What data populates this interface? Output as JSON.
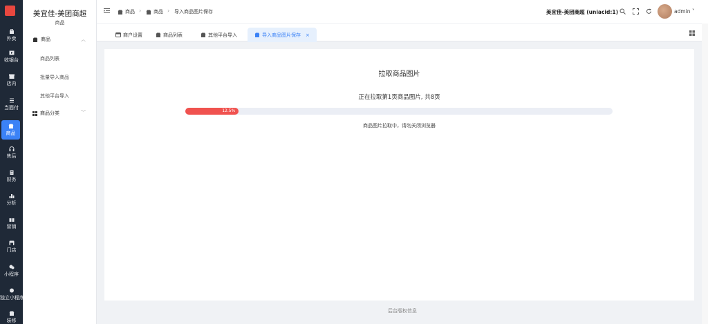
{
  "rail": {
    "logo_text": "美宜佳",
    "items": [
      {
        "label": "外卖",
        "icon": "bag-icon"
      },
      {
        "label": "收银台",
        "icon": "cashier-icon"
      },
      {
        "label": "店内",
        "icon": "store-icon"
      },
      {
        "label": "当面付",
        "icon": "list-icon"
      },
      {
        "label": "商品",
        "icon": "goods-icon",
        "active": true
      },
      {
        "label": "售后",
        "icon": "headset-icon"
      },
      {
        "label": "财务",
        "icon": "finance-icon"
      },
      {
        "label": "分析",
        "icon": "chart-icon"
      },
      {
        "label": "营销",
        "icon": "gift-icon"
      },
      {
        "label": "门店",
        "icon": "shop-icon"
      },
      {
        "label": "小程序",
        "icon": "miniapp-icon"
      },
      {
        "label": "独立小程序",
        "icon": "miniapp-standalone-icon"
      },
      {
        "label": "装修",
        "icon": "decorate-icon"
      }
    ]
  },
  "subnav": {
    "store_name": "美宜佳-美团商超",
    "store_sub": "商品",
    "groups": [
      {
        "label": "商品",
        "icon": "goods-icon",
        "items": [
          "商品列表",
          "批量导入商品",
          "其他平台导入"
        ]
      },
      {
        "label": "商品分类",
        "icon": "category-grid-icon",
        "items": []
      }
    ]
  },
  "header": {
    "breadcrumbs": [
      "商品",
      "商品",
      "导入商品图片保存"
    ],
    "store_title": "美宜佳-美团商超 (uniacid:1)",
    "user": "admin"
  },
  "tabs": [
    {
      "label": "商户设置",
      "icon": "tab-icon"
    },
    {
      "label": "商品列表",
      "icon": "goods-icon"
    },
    {
      "label": "其他平台导入",
      "icon": "goods-icon"
    },
    {
      "label": "导入商品图片保存",
      "icon": "goods-icon",
      "active": true
    }
  ],
  "content": {
    "title": "拉取商品图片",
    "progress_text": "正在拉取第1页商品图片, 共8页",
    "progress_percent": 12.5,
    "progress_label": "12.5%",
    "notice": "商品图片拉取中，请勿关闭浏览器"
  },
  "footer": {
    "text": "后台版权信息"
  },
  "colors": {
    "accent": "#3b82f6",
    "progress": "#f0524f",
    "rail_bg": "#1f2937"
  }
}
